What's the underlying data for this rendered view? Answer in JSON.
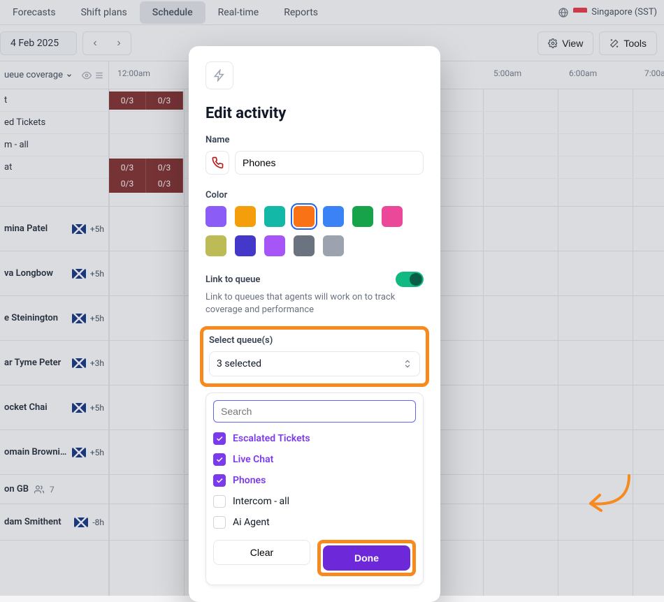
{
  "nav": {
    "tabs": [
      "Forecasts",
      "Shift plans",
      "Schedule",
      "Real-time",
      "Reports"
    ],
    "active_index": 2,
    "locale": "Singapore (SST)"
  },
  "toolbar": {
    "date": "4 Feb 2025",
    "view": "View",
    "tools": "Tools"
  },
  "queues": {
    "header": "ueue coverage",
    "rows": [
      "t",
      "ed Tickets",
      "m - all",
      "at"
    ],
    "coverage_label": "0/3"
  },
  "agents": [
    {
      "name": "mina Patel",
      "flag": "au",
      "tz": "+5h"
    },
    {
      "name": "va Longbow",
      "flag": "au",
      "tz": "+5h"
    },
    {
      "name": "e Steinington",
      "flag": "au",
      "tz": "+5h"
    },
    {
      "name": "ar Tyme Peter",
      "flag": "au",
      "tz": "+3h"
    },
    {
      "name": "ocket Chai",
      "flag": "au",
      "tz": "+5h"
    },
    {
      "name": "omain Browni…",
      "flag": "au",
      "tz": "+5h"
    }
  ],
  "group": {
    "name": "on GB",
    "count": "7"
  },
  "agents_after_group": [
    {
      "name": "dam Smithent",
      "flag": "gb",
      "tz": "-8h"
    }
  ],
  "time_labels": [
    "12:00am",
    "5:00am",
    "6:00am",
    "7:00am"
  ],
  "modal": {
    "title": "Edit activity",
    "name_label": "Name",
    "name_value": "Phones",
    "color_label": "Color",
    "colors": [
      {
        "hex": "#8b5cf6"
      },
      {
        "hex": "#f59e0b"
      },
      {
        "hex": "#14b8a6"
      },
      {
        "hex": "#f97316",
        "selected": true
      },
      {
        "hex": "#3b82f6"
      },
      {
        "hex": "#16a34a"
      },
      {
        "hex": "#ec4899"
      },
      {
        "hex": "#bdbb55"
      },
      {
        "hex": "#4338ca"
      },
      {
        "hex": "#a855f7"
      },
      {
        "hex": "#6b7280"
      },
      {
        "hex": "#9ca3af"
      }
    ],
    "link_label": "Link to queue",
    "link_desc": "Link to queues that agents will work on to track coverage and performance",
    "select_label": "Select queue(s)",
    "select_value": "3 selected",
    "search_placeholder": "Search",
    "options": [
      {
        "label": "Escalated Tickets",
        "checked": true
      },
      {
        "label": "Live Chat",
        "checked": true
      },
      {
        "label": "Phones",
        "checked": true
      },
      {
        "label": "Intercom - all",
        "checked": false
      },
      {
        "label": "Ai Agent",
        "checked": false
      }
    ],
    "clear": "Clear",
    "done": "Done"
  }
}
